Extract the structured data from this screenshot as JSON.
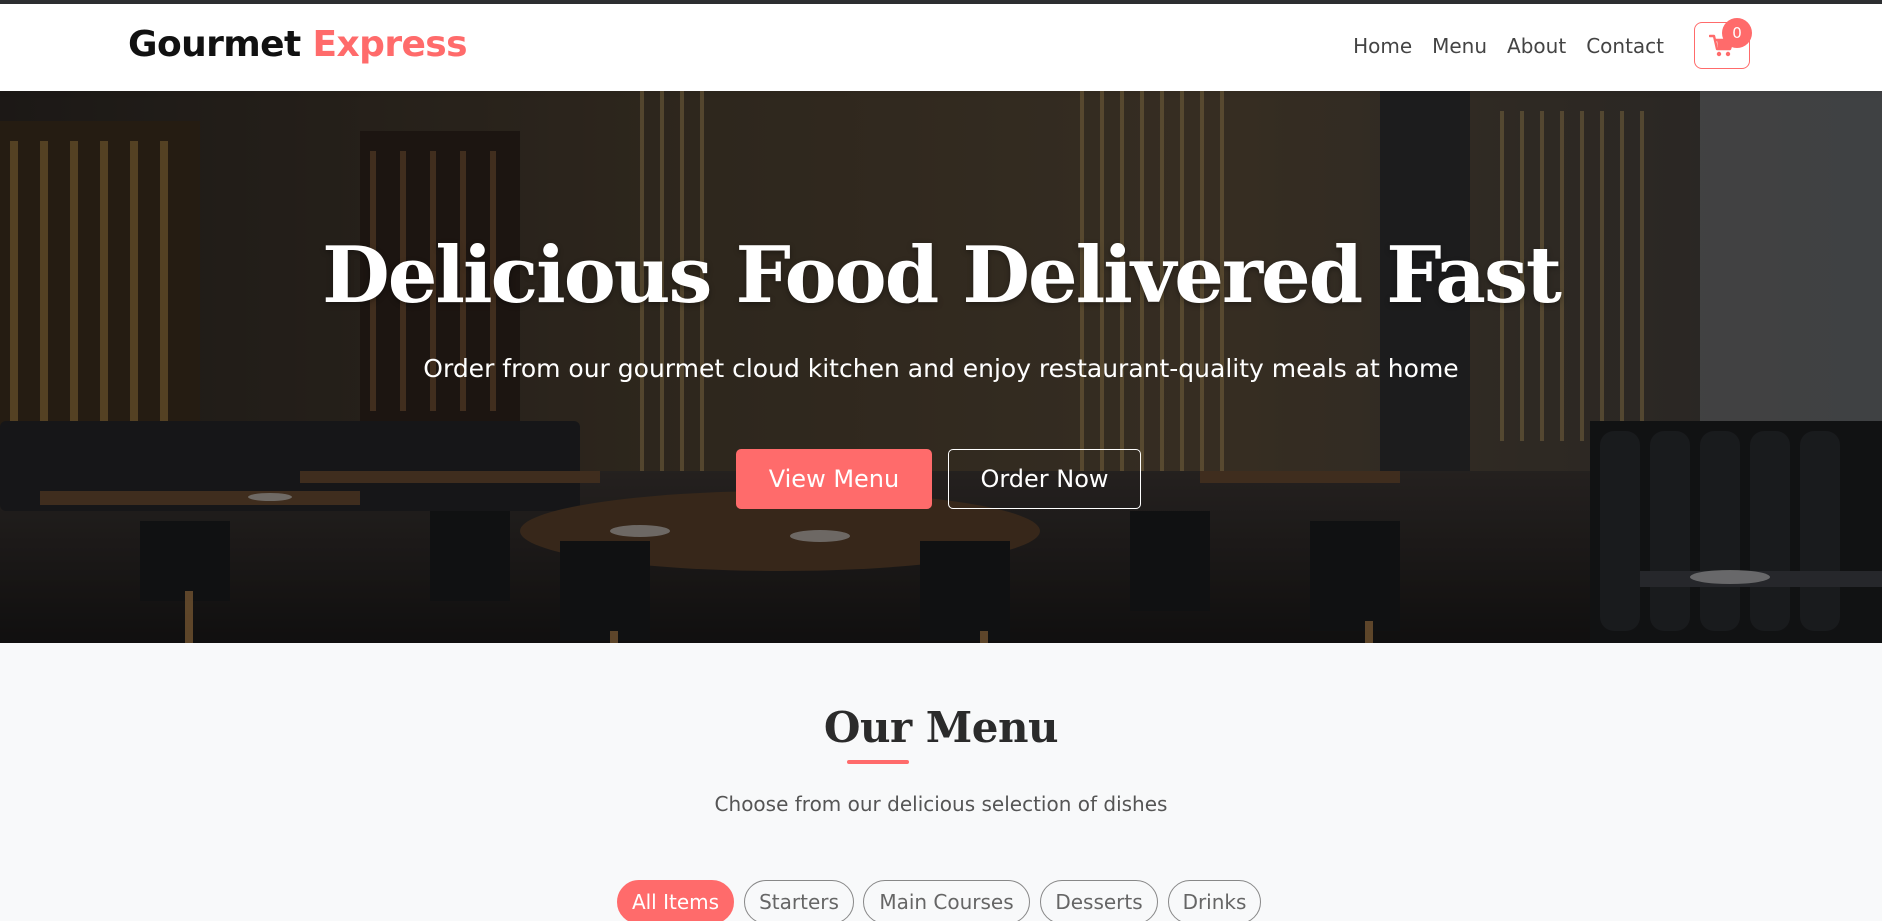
{
  "header": {
    "brand_primary": "Gourmet",
    "brand_accent": "Express",
    "nav": [
      {
        "label": "Home"
      },
      {
        "label": "Menu"
      },
      {
        "label": "About"
      },
      {
        "label": "Contact"
      }
    ],
    "cart": {
      "icon": "cart-icon",
      "count": "0"
    }
  },
  "hero": {
    "title": "Delicious Food Delivered Fast",
    "subtitle": "Order from our gourmet cloud kitchen and enjoy restaurant-quality meals at home",
    "primary_button": "View Menu",
    "secondary_button": "Order Now",
    "background_description": "restaurant-interior"
  },
  "menu_section": {
    "title": "Our Menu",
    "subtitle": "Choose from our delicious selection of dishes",
    "filters": [
      {
        "label": "All Items",
        "active": true
      },
      {
        "label": "Starters",
        "active": false
      },
      {
        "label": "Main Courses",
        "active": false
      },
      {
        "label": "Desserts",
        "active": false
      },
      {
        "label": "Drinks",
        "active": false
      }
    ]
  },
  "colors": {
    "accent": "#ff6b6b",
    "text_dark": "#111111",
    "page_background": "#f8f9fa"
  }
}
